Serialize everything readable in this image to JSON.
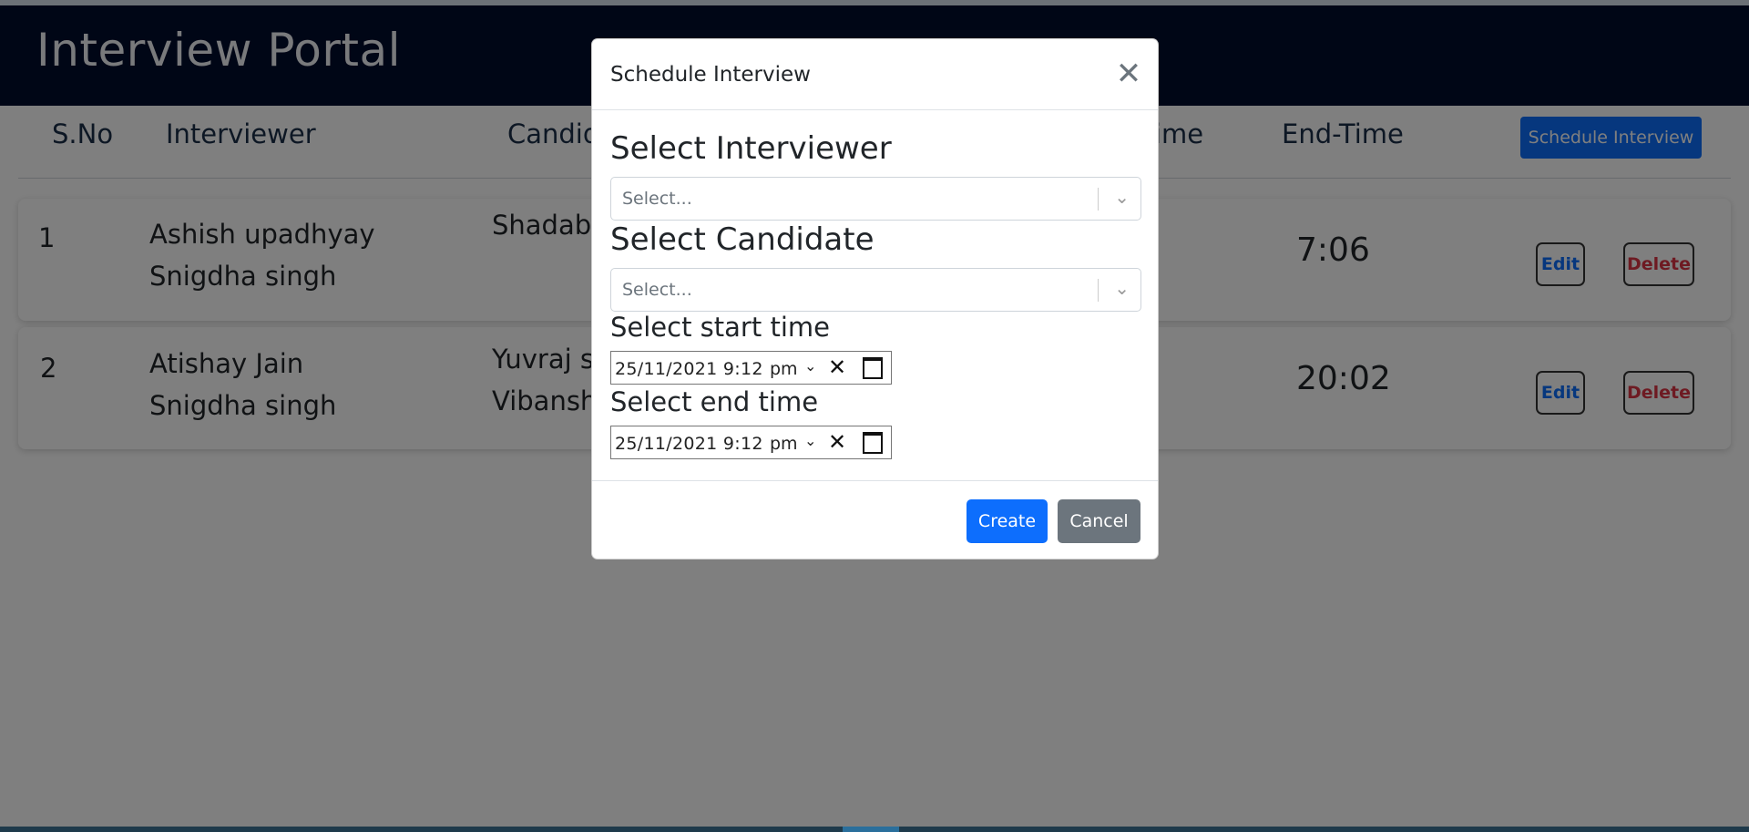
{
  "app": {
    "title": "Interview Portal"
  },
  "table": {
    "headers": {
      "sno": "S.No",
      "interviewer": "Interviewer",
      "candidate": "Candid",
      "start_time": "ime",
      "end_time": "End-Time"
    },
    "schedule_button": "Schedule Interview",
    "rows": [
      {
        "sno": "1",
        "interviewers": [
          "Ashish upadhyay",
          "Snigdha singh"
        ],
        "candidates": [
          "Shadab"
        ],
        "end_time": "7:06",
        "edit": "Edit",
        "delete": "Delete"
      },
      {
        "sno": "2",
        "interviewers": [
          "Atishay Jain",
          "Snigdha singh"
        ],
        "candidates": [
          "Yuvraj si",
          "Vibansh"
        ],
        "end_time": "20:02",
        "edit": "Edit",
        "delete": "Delete"
      }
    ]
  },
  "modal": {
    "title": "Schedule Interview",
    "close_icon": "close-icon",
    "interviewer_label": "Select Interviewer",
    "interviewer_placeholder": "Select...",
    "candidate_label": "Select Candidate",
    "candidate_placeholder": "Select...",
    "start_label": "Select start time",
    "start_value": "25/11/2021  9:12",
    "start_ampm": "pm",
    "end_label": "Select end time",
    "end_value": "25/11/2021  9:12",
    "end_ampm": "pm",
    "create_button": "Create",
    "cancel_button": "Cancel"
  },
  "colors": {
    "navbar": "#010d2d",
    "primary": "#0d6efd",
    "secondary": "#6c757d",
    "danger": "#dc3545"
  }
}
